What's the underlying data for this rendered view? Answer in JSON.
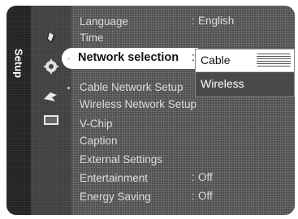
{
  "menu": {
    "category": "Setup",
    "items": [
      {
        "label": "Language",
        "value": "English"
      },
      {
        "label": "Time",
        "value": ""
      },
      {
        "label": "Network selection",
        "value": "Cable"
      },
      {
        "label": "Cable Network Setup",
        "value": ""
      },
      {
        "label": "Wireless Network Setup",
        "value": ""
      },
      {
        "label": "V-Chip",
        "value": ""
      },
      {
        "label": "Caption",
        "value": ""
      },
      {
        "label": "External Settings",
        "value": ""
      },
      {
        "label": "Entertainment",
        "value": "Off"
      },
      {
        "label": "Energy Saving",
        "value": "Off"
      }
    ],
    "colon": ":"
  },
  "dropdown": {
    "options": [
      "Cable",
      "Wireless"
    ]
  },
  "icons": [
    "picture-icon",
    "sound-icon",
    "setup-icon",
    "input-icon",
    "support-icon"
  ]
}
